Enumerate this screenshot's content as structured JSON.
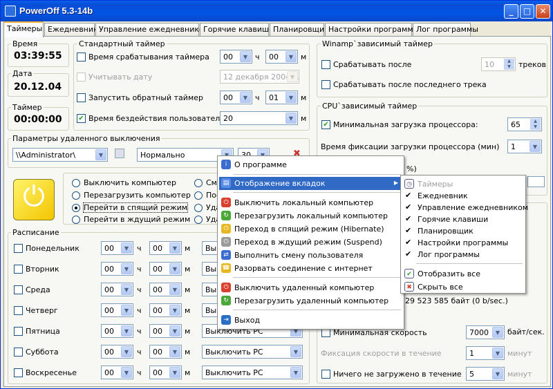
{
  "window": {
    "title": "PowerOff 5.3-14b",
    "min": "_",
    "max": "□",
    "close": "✕"
  },
  "tabs": [
    "Таймеры",
    "Ежедневник",
    "Управление ежедневником",
    "Горячие клавиши",
    "Планировщик",
    "Настройки программы",
    "Лог программы"
  ],
  "left": {
    "time_label": "Время",
    "time_value": "03:39:55",
    "date_label": "Дата",
    "date_value": "20.12.04",
    "timer_label": "Таймер",
    "timer_value": "00:00:00"
  },
  "std": {
    "title": "Стандартный таймер",
    "row1": "Время срабатывания таймера",
    "row2": "Учитывать дату",
    "row2_date": "12  декабря  2004 г.",
    "row3": "Запустить обратный таймер",
    "row4": "Время бездействия  пользователя:",
    "h1": "00",
    "m1": "00",
    "h3": "00",
    "m3": "01",
    "idle": "20",
    "h": "ч",
    "m": "м",
    "check4": "✔"
  },
  "remote": {
    "title": "Параметры удаленного выключения",
    "host": "\\\\Administrator\\",
    "mode": "Нормально",
    "num": "30"
  },
  "actions": {
    "r1": "Выключить компьютер",
    "r2": "Перезагрузить компьютер",
    "r3": "Перейти в спящий режим",
    "r4": "Перейти в ждущий режим",
    "c1": "Сме",
    "c2": "Пое",
    "c3": "Уда",
    "c4": "Уда"
  },
  "schedule": {
    "title": "Расписание",
    "days": [
      "Понедельник",
      "Вторник",
      "Среда",
      "Четверг",
      "Пятница",
      "Суббота",
      "Воскресенье"
    ],
    "h": "00",
    "m": "00",
    "hl": "ч",
    "ml": "м",
    "action": "Выключить PC"
  },
  "winamp": {
    "title": "Winamp`зависимый таймер",
    "after": "Срабатывать после",
    "tracks_val": "10",
    "tracks": "треков",
    "last": "Срабатывать после последнего трека"
  },
  "cpu": {
    "title": "CPU`зависимый таймер",
    "min_load": "Минимальная загрузка процессора:",
    "min_val": "65",
    "fix_time": "Время фиксации загрузки процессора (мин)",
    "fix_val": "1",
    "pct": "%)"
  },
  "net": {
    "bytes": "29 523 585 байт (0 b/sec.)",
    "min_speed": "Минимальная скорость",
    "speed_val": "7000",
    "speed_unit": "байт/сек.",
    "fix": "Фиксация скорости в течение",
    "fix_val": "1",
    "minute": "минут",
    "nothing": "Ничего не загружено в течение",
    "nothing_val": "5"
  },
  "menu": {
    "items": [
      "О программе",
      "Отображение вкладок",
      "Выключить локальный компьютер",
      "Перезагрузить локальный компьютер",
      "Переход в спящий режим (Hibernate)",
      "Переход в ждущий режим (Suspend)",
      "Выполнить смену пользователя",
      "Разорвать соединение с интернет",
      "Выключить удаленный компьютер",
      "Перезагрузить удаленный компьютер",
      "Выход"
    ]
  },
  "submenu": {
    "items": [
      "Таймеры",
      "Ежедневник",
      "Управление ежедневником",
      "Горячие клавиши",
      "Планировщик",
      "Настройки программы",
      "Лог программы"
    ],
    "show_all": "Отобразить все",
    "hide_all": "Скрыть все",
    "check": "✔"
  }
}
